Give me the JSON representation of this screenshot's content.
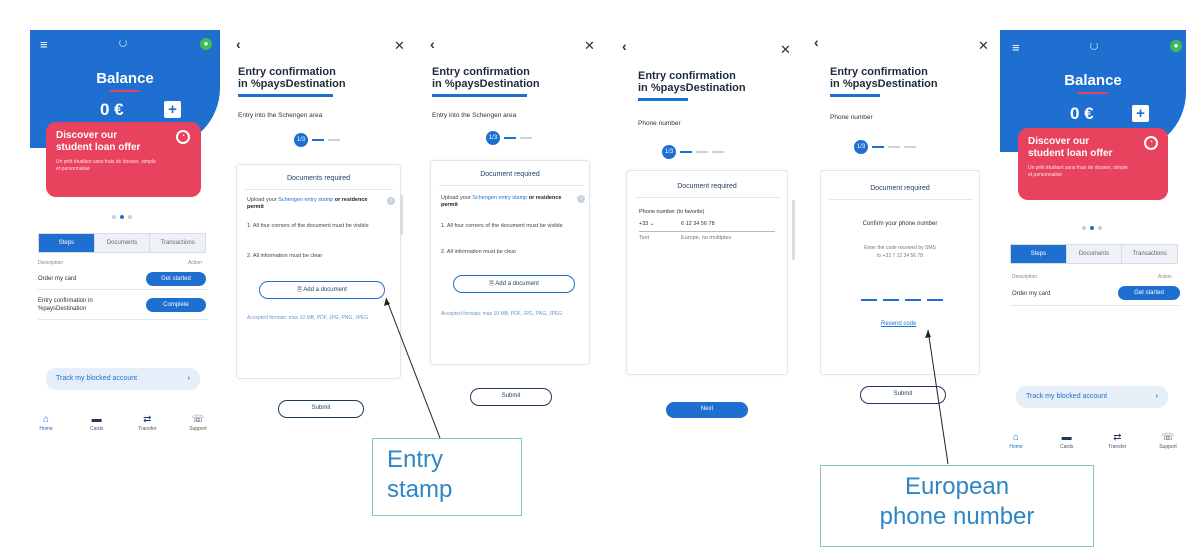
{
  "colors": {
    "brand_blue": "#1f6fd1",
    "promo_pink": "#e9425f",
    "annotation_text": "#2f86c4",
    "annotation_border": "#80c7c7"
  },
  "home": {
    "balance_title": "Balance",
    "balance_amount": "0 €",
    "add_label": "+",
    "promo_title": "Discover our student loan offer",
    "promo_subtitle": "Un prêt étudiant sans frais de dossier, simple et personnalisé",
    "tabs": [
      "Steps",
      "Documents",
      "Transactions"
    ],
    "col_description": "Description",
    "col_action": "Action",
    "rows": [
      {
        "label": "Order my card",
        "action": "Get started"
      },
      {
        "label": "Entry confirmation in %paysDestination",
        "action": "Complete"
      }
    ],
    "track_label": "Track my blocked account",
    "nav": [
      "Home",
      "Cards",
      "Transfer",
      "Support"
    ],
    "nav_icons": [
      "home-icon",
      "card-icon",
      "transfer-icon",
      "support-icon"
    ]
  },
  "home2": {
    "rows": [
      {
        "label": "Order my card",
        "action": "Get started"
      }
    ]
  },
  "flow": {
    "title_line1": "Entry confirmation",
    "title_line2": "in %paysDestination",
    "schengen_subtitle": "Entry into the Schengen area",
    "phone_subtitle": "Phone number",
    "step_label": "1/3",
    "docs_required": "Documents required",
    "doc_required": "Document required",
    "upload_text_a": "Upload your ",
    "upload_link": "Schengen entry stamp",
    "upload_text_b": " or residence permit",
    "bullet1": "All four corners of the document must be visible",
    "bullet2": "All information must be clear",
    "add_doc": "Add a document",
    "accepted_formats": "Accepted formats: max 10 MB, PDF, JPG, PNG, JPEG",
    "submit": "Submit",
    "next": "Next",
    "phone_heading": "Phone number (to favorite)",
    "country_code": "+33",
    "phone_value": "6 12 34 56 78",
    "phone_hint_a": "Text",
    "phone_hint_b": "Europe, no multiples",
    "confirm_phone": "Confirm your phone number",
    "code_sent": "Enter the code received by SMS",
    "code_sent_to": "to +33 7 12 34 56 78",
    "resend": "Resend code"
  },
  "annotations": {
    "entry_stamp": "Entry\nstamp",
    "european_phone": "European\nphone number"
  }
}
